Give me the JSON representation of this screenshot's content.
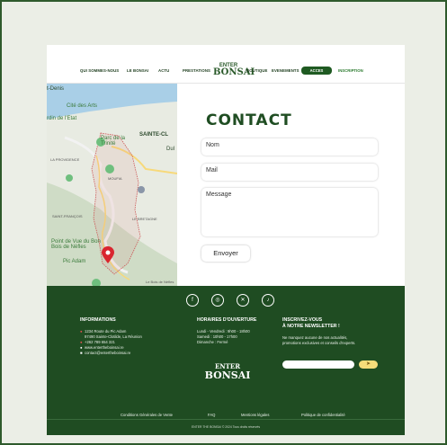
{
  "nav": {
    "items": [
      "QUI SOMMES-NOUS",
      "LE BONSAI",
      "ACTU",
      "PRESTATIONS",
      "BOUTIQUE",
      "EVENEMENTS"
    ],
    "logo_top": "ENTER",
    "logo_bottom": "BONSAI",
    "member_button": "ACCES MEMBRE",
    "signup_link": "INSCRIPTION"
  },
  "map": {
    "labels": [
      "t-Denis",
      "Cité des Arts",
      "rdin de l'Etat",
      "Parc de la Trinité",
      "SAINTE-CL",
      "Point de Vue du Bon Bois de Nèfles",
      "Pic Adam",
      "LE BRETAGNE",
      "LA PROVIDENCE",
      "SAINT-FRANÇOIS",
      "MOUFIA",
      "Le Bois de Nèfles",
      "Dul"
    ]
  },
  "contact": {
    "title": "CONTACT",
    "name_placeholder": "Nom",
    "email_placeholder": "Mail",
    "message_placeholder": "Message",
    "send_label": "Envoyer"
  },
  "footer": {
    "social_icons": [
      "facebook-icon",
      "instagram-icon",
      "x-icon",
      "tiktok-icon"
    ],
    "info_title": "INFORMATIONS",
    "address_1": "1234 Route du Pic Adam",
    "address_2": "97490 Sainte-Clotilde, La Réunion",
    "phone": "+262 789 654 321",
    "website": "www.entertheboinsai.re",
    "email": "contact@entertheboinsai.re",
    "hours_title": "HORAIRES D'OUVERTURE",
    "hours_1": "Lundi - Vendredi : 9h00 - 18h00",
    "hours_2": "Samedi : 10h00 - 17h00",
    "hours_3": "Dimanche : Fermé",
    "newsletter_title_1": "INSCRIVEZ-VOUS",
    "newsletter_title_2": "À NOTRE NEWSLETTER !",
    "newsletter_text_1": "Ne manquez aucune de nos actualités,",
    "newsletter_text_2": "promotions exclusives et conseils d'experts.",
    "logo_top": "ENTER",
    "logo_mid": "BONSAI",
    "links": [
      "Conditions Générales de Vente",
      "FAQ",
      "Mentions légales",
      "Politique de confidentialité"
    ],
    "copyright": "ENTER THE BONSAI © 2024 Tous droits réservés"
  },
  "colors": {
    "primary_green": "#1f4c22",
    "accent_yellow": "#f5dc7a",
    "pin_red": "#d9252f"
  }
}
